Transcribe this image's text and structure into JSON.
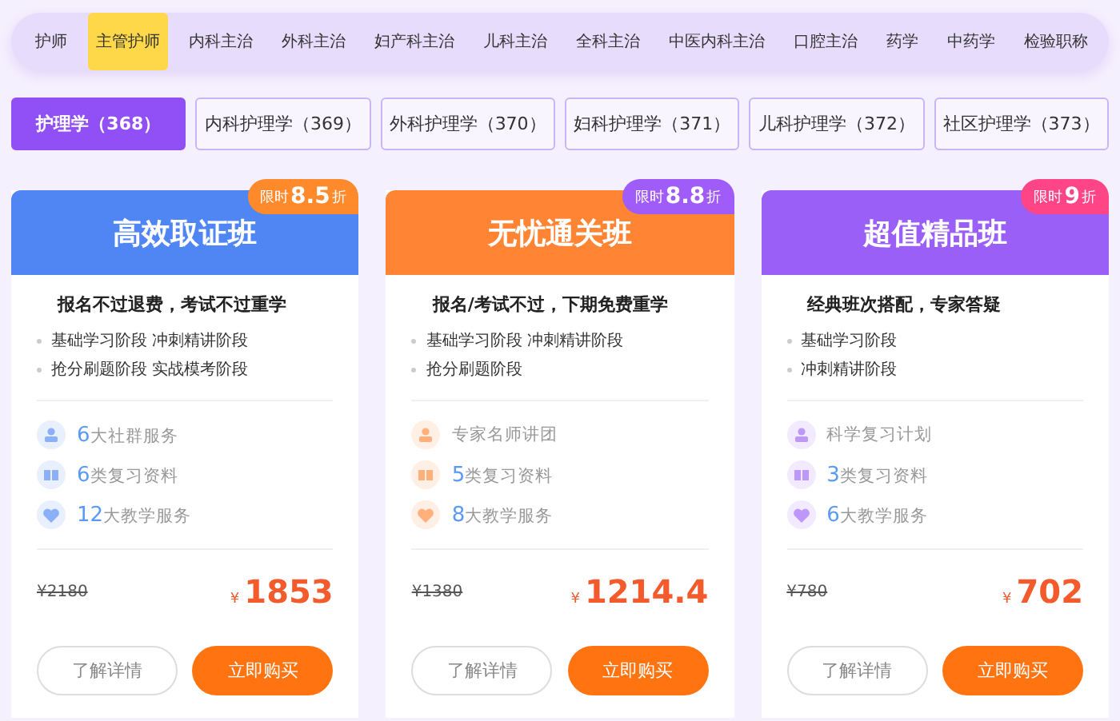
{
  "top_tabs": [
    {
      "label": "护师",
      "selected": false
    },
    {
      "label": "主管护师",
      "selected": true
    },
    {
      "label": "内科主治",
      "selected": false
    },
    {
      "label": "外科主治",
      "selected": false
    },
    {
      "label": "妇产科主治",
      "selected": false
    },
    {
      "label": "儿科主治",
      "selected": false
    },
    {
      "label": "全科主治",
      "selected": false
    },
    {
      "label": "中医内科主治",
      "selected": false
    },
    {
      "label": "口腔主治",
      "selected": false
    },
    {
      "label": "药学",
      "selected": false
    },
    {
      "label": "中药学",
      "selected": false
    },
    {
      "label": "检验职称",
      "selected": false
    }
  ],
  "sub_tabs": [
    {
      "label": "护理学（368）",
      "selected": true
    },
    {
      "label": "内科护理学（369）",
      "selected": false
    },
    {
      "label": "外科护理学（370）",
      "selected": false
    },
    {
      "label": "妇科护理学（371）",
      "selected": false
    },
    {
      "label": "儿科护理学（372）",
      "selected": false
    },
    {
      "label": "社区护理学（373）",
      "selected": false
    }
  ],
  "cards": [
    {
      "color": "#4f86f3",
      "title": "高效取证班",
      "badge": {
        "color": "#ff8a2c",
        "prefix": "限时",
        "value": "8.5",
        "suffix": "折"
      },
      "slogan": "报名不过退费，考试不过重学",
      "stages": [
        "基础学习阶段 冲刺精讲阶段",
        "抢分刷题阶段 实战模考阶段"
      ],
      "features": [
        {
          "kind": "person",
          "number": "6",
          "text": "大社群服务"
        },
        {
          "kind": "book",
          "number": "6",
          "text": "类复习资料"
        },
        {
          "kind": "heart",
          "number": "12",
          "text": "大教学服务"
        }
      ],
      "old_price": "¥2180",
      "currency": "¥",
      "price": "1853",
      "details_button": "了解详情",
      "buy_button": "立即购买"
    },
    {
      "color": "#ff8535",
      "title": "无忧通关班",
      "badge": {
        "color": "#a05cf8",
        "prefix": "限时",
        "value": "8.8",
        "suffix": "折"
      },
      "slogan": "报名/考试不过，下期免费重学",
      "stages": [
        "基础学习阶段 冲刺精讲阶段",
        "抢分刷题阶段"
      ],
      "features": [
        {
          "kind": "person",
          "text": "专家名师讲团"
        },
        {
          "kind": "book",
          "number": "5",
          "text": "类复习资料"
        },
        {
          "kind": "heart",
          "number": "8",
          "text": "大教学服务"
        }
      ],
      "old_price": "¥1380",
      "currency": "¥",
      "price": "1214.4",
      "details_button": "了解详情",
      "buy_button": "立即购买"
    },
    {
      "color": "#9a5ff7",
      "title": "超值精品班",
      "badge": {
        "color": "#ff4586",
        "prefix": "限时",
        "value": "9",
        "suffix": "折"
      },
      "slogan": "经典班次搭配，专家答疑",
      "stages": [
        "基础学习阶段",
        "冲刺精讲阶段"
      ],
      "features": [
        {
          "kind": "person",
          "text": "科学复习计划"
        },
        {
          "kind": "book",
          "number": "3",
          "text": "类复习资料"
        },
        {
          "kind": "heart",
          "number": "6",
          "text": "大教学服务"
        }
      ],
      "old_price": "¥780",
      "currency": "¥",
      "price": "702",
      "details_button": "了解详情",
      "buy_button": "立即购买"
    }
  ]
}
